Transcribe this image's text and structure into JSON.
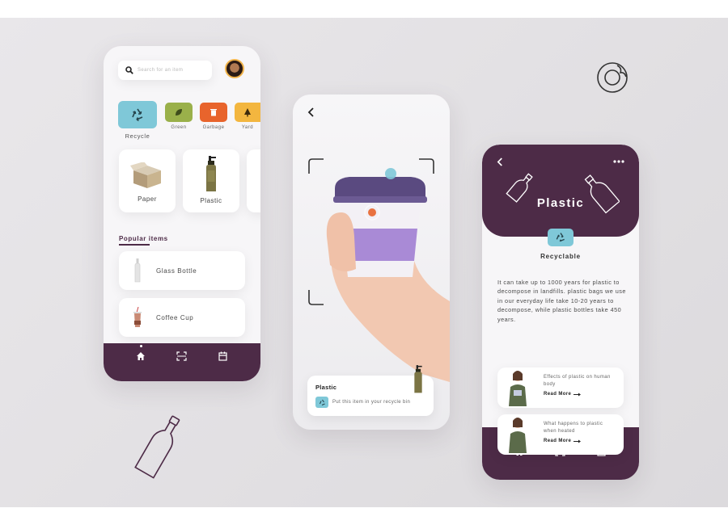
{
  "phone1": {
    "search_placeholder": "Search for an item",
    "categories": [
      {
        "label": "Recycle",
        "icon": "recycle-icon",
        "color": "#7fc8d8"
      },
      {
        "label": "Green",
        "icon": "leaf-icon",
        "color": "#9ab04a"
      },
      {
        "label": "Garbage",
        "icon": "trash-icon",
        "color": "#e8642c"
      },
      {
        "label": "Yard",
        "icon": "tree-icon",
        "color": "#f3b63f"
      }
    ],
    "materials": [
      {
        "label": "Paper",
        "icon": "box-icon"
      },
      {
        "label": "Plastic",
        "icon": "bottle-icon"
      }
    ],
    "popular_heading": "Popular items",
    "popular_items": [
      {
        "label": "Glass Bottle",
        "icon": "glass-bottle-icon"
      },
      {
        "label": "Coffee Cup",
        "icon": "coffee-cup-icon"
      }
    ]
  },
  "phone2": {
    "result_title": "Plastic",
    "result_text": "Put this item in your recycle bin"
  },
  "phone3": {
    "title": "Plastic",
    "badge_label": "Recyclable",
    "description": "It can take up to 1000 years for plastic to decompose in landfills. plastic bags we use in our everyday life take 10-20 years to decompose, while plastic bottles take 450 years.",
    "articles": [
      {
        "title": "Effects of plastic on human body",
        "link": "Read More"
      },
      {
        "title": "What happens to plastic when heated",
        "link": "Read More"
      }
    ]
  },
  "colors": {
    "plum": "#4d2b47",
    "teal": "#7fc8d8",
    "lilac": "#a98ad6"
  }
}
